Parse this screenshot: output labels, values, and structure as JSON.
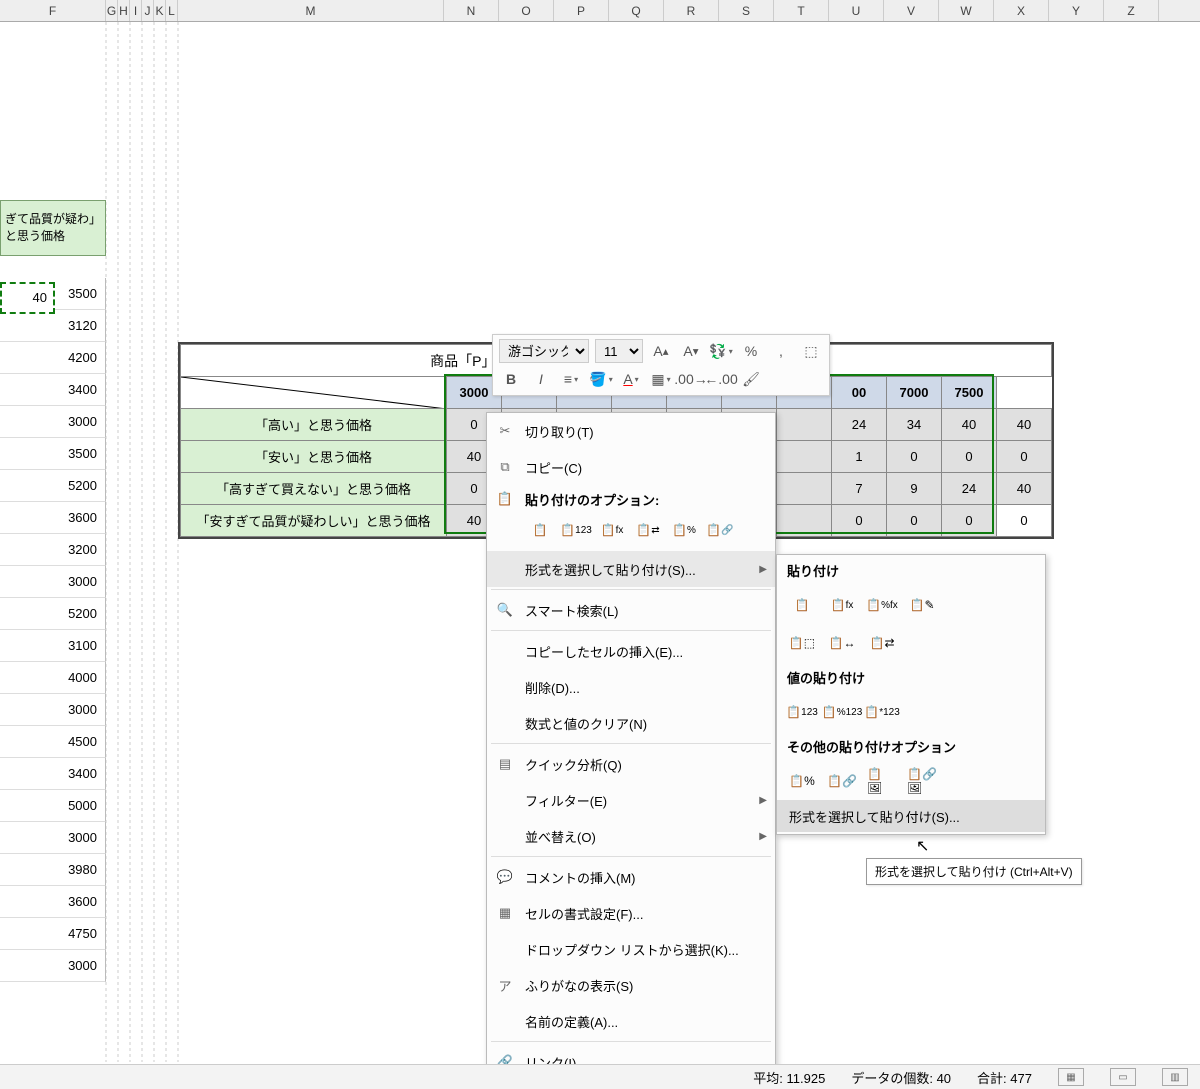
{
  "columns": [
    "F",
    "G",
    "H",
    "I",
    "J",
    "K",
    "L",
    "M",
    "N",
    "O",
    "P",
    "Q",
    "R",
    "S",
    "T",
    "U",
    "V",
    "W",
    "X",
    "Y",
    "Z"
  ],
  "col_f_values": [
    "3500",
    "3120",
    "4200",
    "3400",
    "3000",
    "3500",
    "5200",
    "3600",
    "3200",
    "3000",
    "5200",
    "3100",
    "4000",
    "3000",
    "4500",
    "3400",
    "5000",
    "3000",
    "3980",
    "3600",
    "4750",
    "3000"
  ],
  "header_f": "ぎて品質が疑わ」と思う価格",
  "marching_value": "40",
  "table": {
    "title": "商品「P」",
    "col_headers": [
      "3000",
      "",
      "",
      "",
      "",
      "",
      "",
      "00",
      "7000",
      "7500"
    ],
    "row_labels": [
      "「高い」と思う価格",
      "「安い」と思う価格",
      "「高すぎて買えない」と思う価格",
      "「安すぎて品質が疑わしい」と思う価格"
    ],
    "data": [
      [
        "0",
        "",
        "",
        "",
        "",
        "",
        "",
        "24",
        "34",
        "40",
        "40"
      ],
      [
        "40",
        "",
        "",
        "",
        "",
        "",
        "",
        "1",
        "0",
        "0",
        "0"
      ],
      [
        "0",
        "",
        "",
        "",
        "",
        "",
        "",
        "7",
        "9",
        "24",
        "40"
      ],
      [
        "40",
        "",
        "",
        "",
        "",
        "",
        "",
        "0",
        "0",
        "0",
        "0"
      ]
    ]
  },
  "mini_toolbar": {
    "font": "游ゴシック",
    "size": "11"
  },
  "ctx": {
    "cut": "切り取り(T)",
    "copy": "コピー(C)",
    "paste_options": "貼り付けのオプション:",
    "paste_special": "形式を選択して貼り付け(S)...",
    "smart_lookup": "スマート検索(L)",
    "insert_copied": "コピーしたセルの挿入(E)...",
    "delete": "削除(D)...",
    "clear": "数式と値のクリア(N)",
    "quick_analysis": "クイック分析(Q)",
    "filter": "フィルター(E)",
    "sort": "並べ替え(O)",
    "insert_comment": "コメントの挿入(M)",
    "format_cells": "セルの書式設定(F)...",
    "pick_from_list": "ドロップダウン リストから選択(K)...",
    "show_phonetic": "ふりがなの表示(S)",
    "define_name": "名前の定義(A)...",
    "link": "リンク(I)"
  },
  "sub": {
    "paste": "貼り付け",
    "paste_values": "値の貼り付け",
    "other": "その他の貼り付けオプション",
    "special": "形式を選択して貼り付け(S)..."
  },
  "tooltip": "形式を選択して貼り付け (Ctrl+Alt+V)",
  "status": {
    "avg_label": "平均:",
    "avg": "11.925",
    "count_label": "データの個数:",
    "count": "40",
    "sum_label": "合計:",
    "sum": "477"
  }
}
